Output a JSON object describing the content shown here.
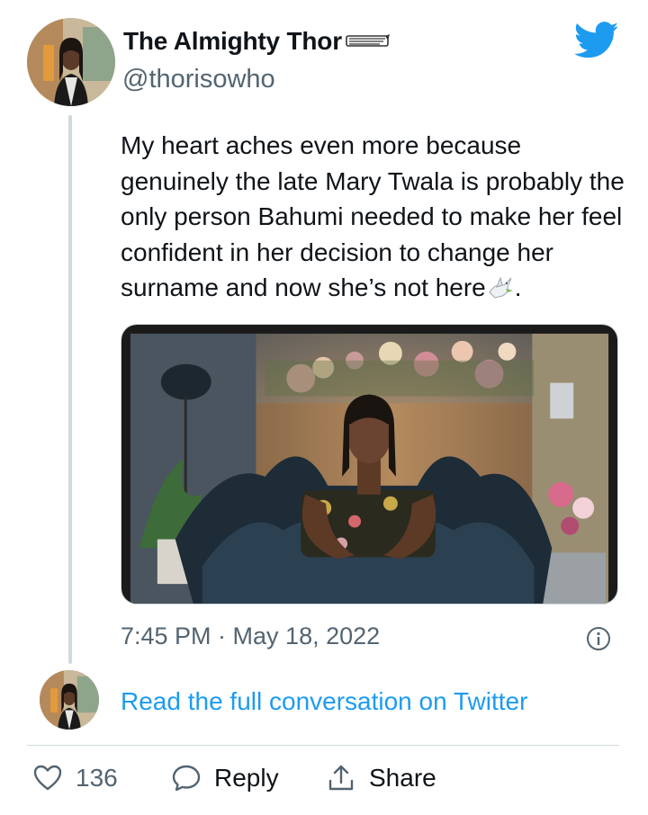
{
  "author": {
    "display_name": "The Almighty Thor",
    "handle": "@thorisowho",
    "name_emoji": "wing-emoji"
  },
  "tweet": {
    "text": "My heart aches even more because genuinely the late Mary Twala is probably the only person Bahumi needed to make her feel confident in her decision to change her surname and now she’s not here",
    "text_end": ".",
    "text_emoji": "dove-emoji",
    "timestamp": "7:45 PM · May 18, 2022",
    "media_description": "woman in floral off-shoulder dress with black tulle"
  },
  "conversation": {
    "read_link": "Read the full conversation on Twitter"
  },
  "actions": {
    "like_count": "136",
    "reply_label": "Reply",
    "share_label": "Share"
  },
  "colors": {
    "twitter_blue": "#1d9bf0",
    "secondary_text": "#536471",
    "divider": "#cfd9de"
  }
}
